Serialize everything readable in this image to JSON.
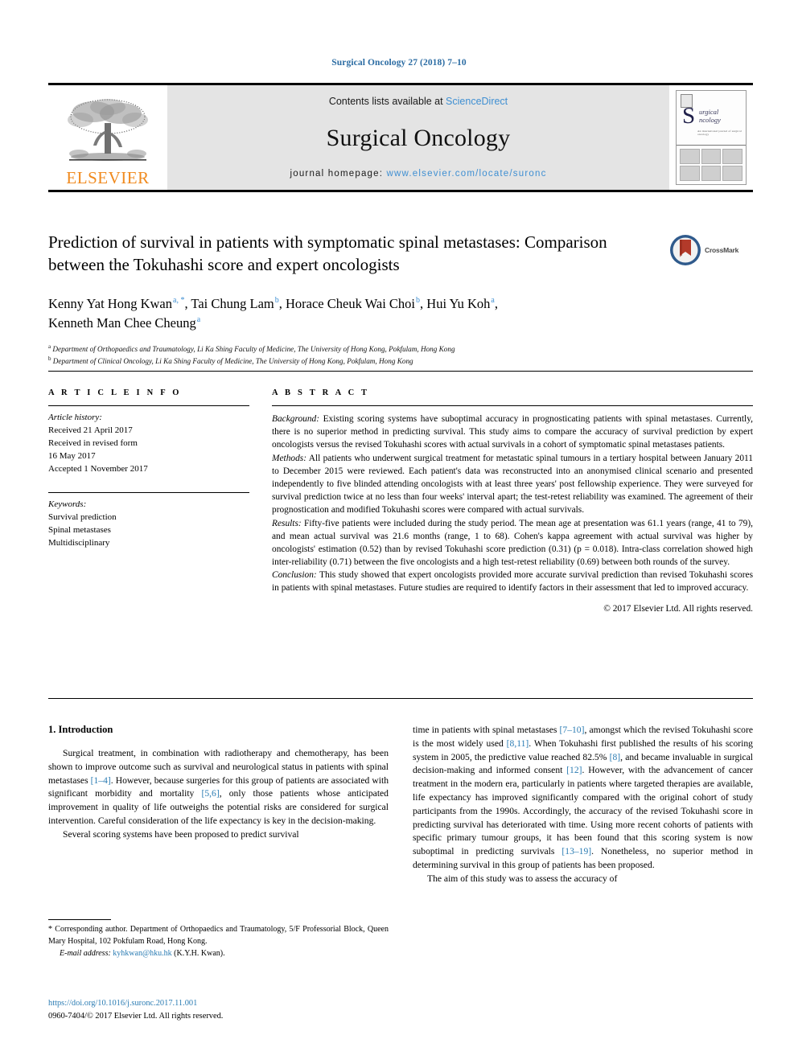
{
  "running_head": "Surgical Oncology 27 (2018) 7–10",
  "masthead": {
    "publisher_name": "ELSEVIER",
    "contents_prefix": "Contents lists available at ",
    "contents_link": "ScienceDirect",
    "journal_title": "Surgical Oncology",
    "homepage_prefix": "journal homepage: ",
    "homepage_url": "www.elsevier.com/locate/suronc",
    "cover_s_glyph": "S",
    "cover_words": "urgical\nncology",
    "cover_tagline": "An international journal of surgical oncology"
  },
  "article": {
    "title": "Prediction of survival in patients with symptomatic spinal metastases: Comparison between the Tokuhashi score and expert oncologists",
    "crossmark_label": "CrossMark",
    "authors_line1_a": "Kenny Yat Hong Kwan",
    "authors_line1_sup_a": "a, *",
    "authors_line1_b": ", Tai Chung Lam",
    "authors_line1_sup_b": "b",
    "authors_line1_c": ", Horace Cheuk Wai Choi",
    "authors_line1_sup_c": "b",
    "authors_line1_d": ", Hui Yu Koh",
    "authors_line1_sup_d": "a",
    "authors_line1_e": ",",
    "authors_line2": "Kenneth Man Chee Cheung",
    "authors_line2_sup": "a",
    "affiliation_a_sup": "a",
    "affiliation_a": "Department of Orthopaedics and Traumatology, Li Ka Shing Faculty of Medicine, The University of Hong Kong, Pokfulam, Hong Kong",
    "affiliation_b_sup": "b",
    "affiliation_b": "Department of Clinical Oncology, Li Ka Shing Faculty of Medicine, The University of Hong Kong, Pokfulam, Hong Kong"
  },
  "article_info": {
    "heading": "A R T I C L E   I N F O",
    "history_label": "Article history:",
    "history_lines": [
      "Received 21 April 2017",
      "Received in revised form",
      "16 May 2017",
      "Accepted 1 November 2017"
    ],
    "keywords_label": "Keywords:",
    "keywords": [
      "Survival prediction",
      "Spinal metastases",
      "Multidisciplinary"
    ]
  },
  "abstract": {
    "heading": "A B S T R A C T",
    "sections": [
      {
        "label": "Background:",
        "text": " Existing scoring systems have suboptimal accuracy in prognosticating patients with spinal metastases. Currently, there is no superior method in predicting survival. This study aims to compare the accuracy of survival prediction by expert oncologists versus the revised Tokuhashi scores with actual survivals in a cohort of symptomatic spinal metastases patients."
      },
      {
        "label": "Methods:",
        "text": " All patients who underwent surgical treatment for metastatic spinal tumours in a tertiary hospital between January 2011 to December 2015 were reviewed. Each patient's data was reconstructed into an anonymised clinical scenario and presented independently to five blinded attending oncologists with at least three years' post fellowship experience. They were surveyed for survival prediction twice at no less than four weeks' interval apart; the test-retest reliability was examined. The agreement of their prognostication and modified Tokuhashi scores were compared with actual survivals."
      },
      {
        "label": "Results:",
        "text": " Fifty-five patients were included during the study period. The mean age at presentation was 61.1 years (range, 41 to 79), and mean actual survival was 21.6 months (range, 1 to 68). Cohen's kappa agreement with actual survival was higher by oncologists' estimation (0.52) than by revised Tokuhashi score prediction (0.31) (p = 0.018). Intra-class correlation showed high inter-reliability (0.71) between the five oncologists and a high test-retest reliability (0.69) between both rounds of the survey."
      },
      {
        "label": "Conclusion:",
        "text": " This study showed that expert oncologists provided more accurate survival prediction than revised Tokuhashi scores in patients with spinal metastases. Future studies are required to identify factors in their assessment that led to improved accuracy."
      }
    ],
    "copyright": "© 2017 Elsevier Ltd. All rights reserved."
  },
  "body": {
    "section_number_title": "1. Introduction",
    "left_paragraph_1": {
      "part1": "Surgical treatment, in combination with radiotherapy and chemotherapy, has been shown to improve outcome such as survival and neurological status in patients with spinal metastases ",
      "ref1": "[1–4]",
      "part2": ". However, because surgeries for this group of patients are associated with significant morbidity and mortality ",
      "ref2": "[5,6]",
      "part3": ", only those patients whose anticipated improvement in quality of life outweighs the potential risks are considered for surgical intervention. Careful consideration of the life expectancy is key in the decision-making."
    },
    "left_paragraph_2": "Several scoring systems have been proposed to predict survival",
    "right_paragraph_1": {
      "part1": "time in patients with spinal metastases ",
      "ref1": "[7–10]",
      "part2": ", amongst which the revised Tokuhashi score is the most widely used ",
      "ref2": "[8,11]",
      "part3": ". When Tokuhashi first published the results of his scoring system in 2005, the predictive value reached 82.5% ",
      "ref3": "[8]",
      "part4": ", and became invaluable in surgical decision-making and informed consent ",
      "ref4": "[12]",
      "part5": ". However, with the advancement of cancer treatment in the modern era, particularly in patients where targeted therapies are available, life expectancy has improved significantly compared with the original cohort of study participants from the 1990s. Accordingly, the accuracy of the revised Tokuhashi score in predicting survival has deteriorated with time. Using more recent cohorts of patients with specific primary tumour groups, it has been found that this scoring system is now suboptimal in predicting survivals ",
      "ref5": "[13–19]",
      "part6": ". Nonetheless, no superior method in determining survival in this group of patients has been proposed."
    },
    "right_paragraph_2": "The aim of this study was to assess the accuracy of"
  },
  "footer": {
    "corresponding_marker": "*",
    "corresponding_text": " Corresponding author. Department of Orthopaedics and Traumatology, 5/F Professorial Block, Queen Mary Hospital, 102 Pokfulam Road, Hong Kong.",
    "email_label": "E-mail address:",
    "email_address": " kyhkwan@hku.hk",
    "email_owner": " (K.Y.H. Kwan).",
    "doi": "https://doi.org/10.1016/j.suronc.2017.11.001",
    "issn_copyright": "0960-7404/© 2017 Elsevier Ltd. All rights reserved."
  },
  "colors": {
    "link_blue": "#2b7cb3",
    "sciencedirect_blue": "#3f8fd2",
    "elsevier_orange": "#F08A1E",
    "masthead_gray": "#e4e4e4"
  }
}
